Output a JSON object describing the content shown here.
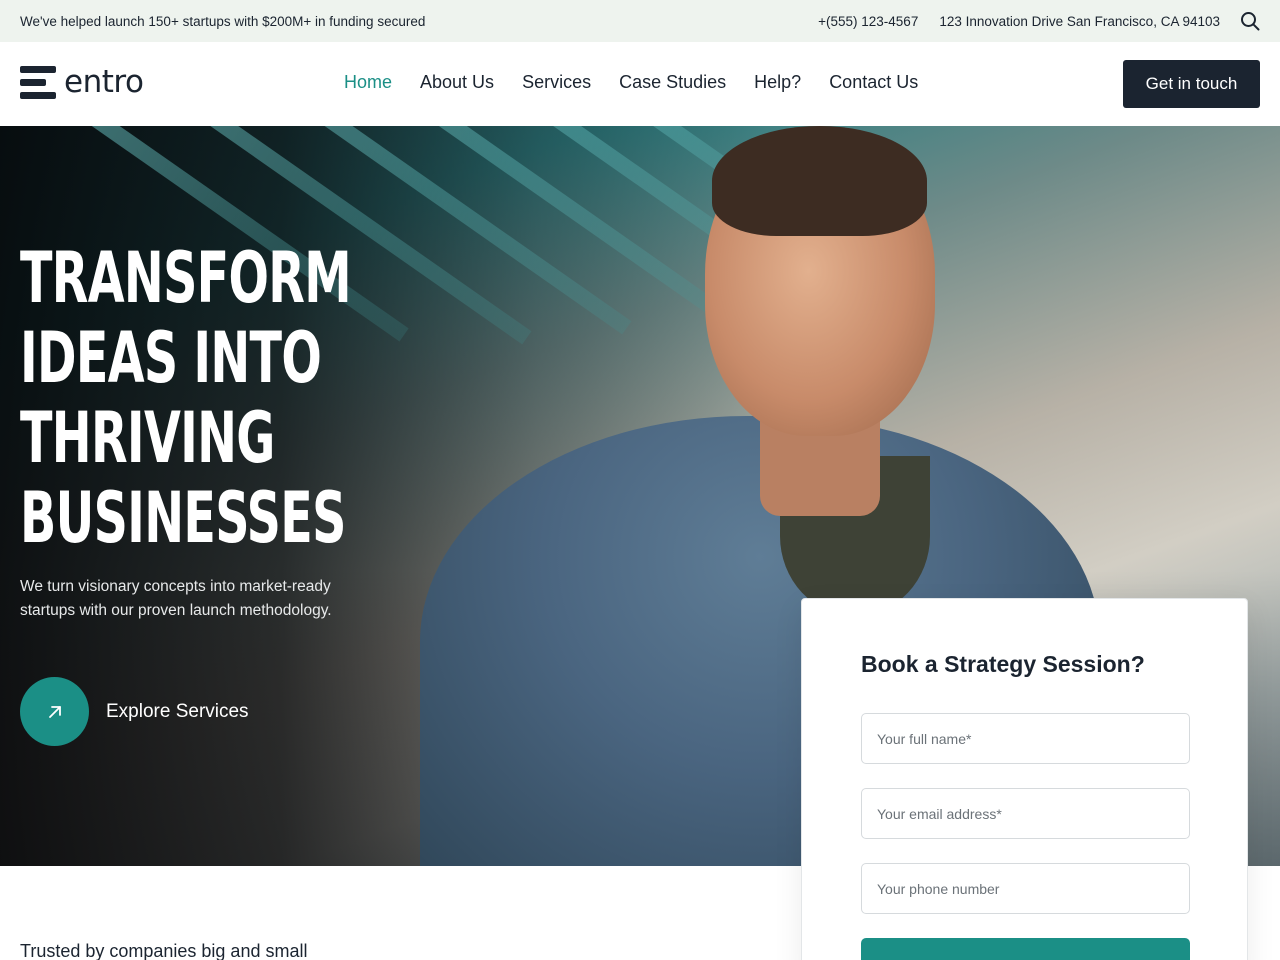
{
  "topbar": {
    "promo": "We've helped launch 150+ startups with $200M+ in funding secured",
    "phone": "+(555) 123-4567",
    "address": "123 Innovation Drive San Francisco, CA 94103",
    "search_icon": "search-icon"
  },
  "header": {
    "logo_text": "entro",
    "nav": [
      {
        "label": "Home",
        "active": true
      },
      {
        "label": "About Us"
      },
      {
        "label": "Services"
      },
      {
        "label": "Case Studies"
      },
      {
        "label": "Help?"
      },
      {
        "label": "Contact Us"
      }
    ],
    "cta_label": "Get in touch"
  },
  "hero": {
    "title_lines": [
      "TRANSFORM",
      "IDEAS INTO",
      "THRIVING",
      "BUSINESSES"
    ],
    "subtitle": "We turn visionary concepts into market-ready startups with our proven launch methodology.",
    "explore_label": "Explore Services",
    "explore_icon": "arrow-up-right-icon"
  },
  "form": {
    "title": "Book a Strategy Session?",
    "name_placeholder": "Your full name*",
    "email_placeholder": "Your email address*",
    "phone_placeholder": "Your phone number"
  },
  "trusted": {
    "heading": "Trusted by companies big and small"
  },
  "colors": {
    "accent": "#1b8f86",
    "dark": "#1b2430",
    "topbar_bg": "#eef3ee"
  }
}
